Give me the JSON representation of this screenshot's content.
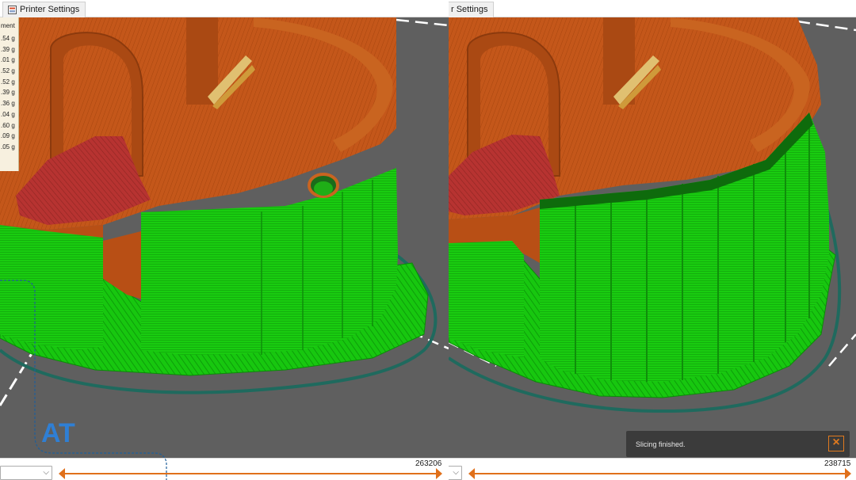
{
  "left_panel": {
    "tab_label": "Printer Settings",
    "move_count": "263206",
    "legend": {
      "header": "ment",
      "weights": [
        ".54 g",
        ".39 g",
        ".01 g",
        ".52 g",
        ".52 g",
        ".39 g",
        ".36 g",
        ".04 g",
        ".60 g",
        ".09 g",
        ".05 g"
      ]
    }
  },
  "right_panel": {
    "tab_label": "r Settings",
    "move_count": "238715",
    "toast": {
      "message": "Slicing finished.",
      "close_icon": "close-x-icon"
    }
  },
  "watermark": {
    "letters": "AT"
  },
  "colors": {
    "background": "#5f5f5f",
    "support_green": "#17c70f",
    "object_orange": "#c4571a",
    "overhang_red": "#b42e2a",
    "skirt_teal": "#1f6a5e",
    "slider_orange": "#e0701b",
    "toast_bg": "#3b3b3b",
    "accent_icon": "#e07a1f"
  }
}
